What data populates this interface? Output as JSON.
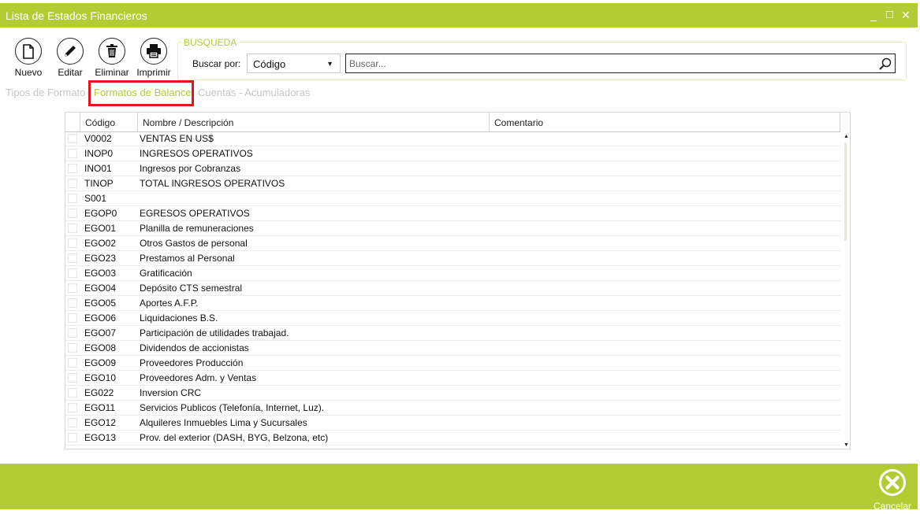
{
  "window": {
    "title": "Lista de Estados Financieros",
    "controls": {
      "minimize": "_",
      "maximize": "□",
      "close": "✕"
    },
    "accent_color": "#b4cc34"
  },
  "toolbar": {
    "nuevo_label": "Nuevo",
    "editar_label": "Editar",
    "eliminar_label": "Eliminar",
    "imprimir_label": "Imprimir"
  },
  "search": {
    "group_title": "BUSQUEDA",
    "by_label": "Buscar por:",
    "by_value": "Código",
    "placeholder": "Buscar..."
  },
  "tabs": [
    {
      "label": "Tipos de Formato",
      "active": false
    },
    {
      "label": "Formatos de Balance",
      "active": true
    },
    {
      "label": "Cuentas - Acumuladoras",
      "active": false
    }
  ],
  "grid": {
    "columns": [
      "Código",
      "Nombre / Descripción",
      "Comentario"
    ],
    "rows": [
      {
        "code": "V0002",
        "name": "VENTAS EN US$",
        "comment": ""
      },
      {
        "code": "INOP0",
        "name": "INGRESOS OPERATIVOS",
        "comment": ""
      },
      {
        "code": "INO01",
        "name": "Ingresos por Cobranzas",
        "comment": ""
      },
      {
        "code": "TINOP",
        "name": "TOTAL INGRESOS OPERATIVOS",
        "comment": ""
      },
      {
        "code": "S001",
        "name": "",
        "comment": ""
      },
      {
        "code": "EGOP0",
        "name": "EGRESOS OPERATIVOS",
        "comment": ""
      },
      {
        "code": "EGO01",
        "name": "Planilla de remuneraciones",
        "comment": ""
      },
      {
        "code": "EGO02",
        "name": "Otros Gastos de personal",
        "comment": ""
      },
      {
        "code": "EGO23",
        "name": "Prestamos al Personal",
        "comment": ""
      },
      {
        "code": "EGO03",
        "name": "Gratificación",
        "comment": ""
      },
      {
        "code": "EGO04",
        "name": "Depósito CTS semestral",
        "comment": ""
      },
      {
        "code": "EGO05",
        "name": "Aportes A.F.P.",
        "comment": ""
      },
      {
        "code": "EGO06",
        "name": "Liquidaciones B.S.",
        "comment": ""
      },
      {
        "code": "EGO07",
        "name": "Participación de utilidades trabajad.",
        "comment": ""
      },
      {
        "code": "EGO08",
        "name": "Dividendos de accionistas",
        "comment": ""
      },
      {
        "code": "EGO09",
        "name": "Proveedores Producción",
        "comment": ""
      },
      {
        "code": "EGO10",
        "name": "Proveedores Adm. y Ventas",
        "comment": ""
      },
      {
        "code": "EG022",
        "name": "Inversion CRC",
        "comment": ""
      },
      {
        "code": "EGO11",
        "name": "Servicios Publicos (Telefonía, Internet, Luz).",
        "comment": ""
      },
      {
        "code": "EGO12",
        "name": "Alquileres Inmuebles Lima y Sucursales",
        "comment": ""
      },
      {
        "code": "EGO13",
        "name": "Prov. del exterior (DASH, BYG, Belzona, etc)",
        "comment": ""
      }
    ]
  },
  "footer": {
    "cancel_label": "Cancelar"
  }
}
